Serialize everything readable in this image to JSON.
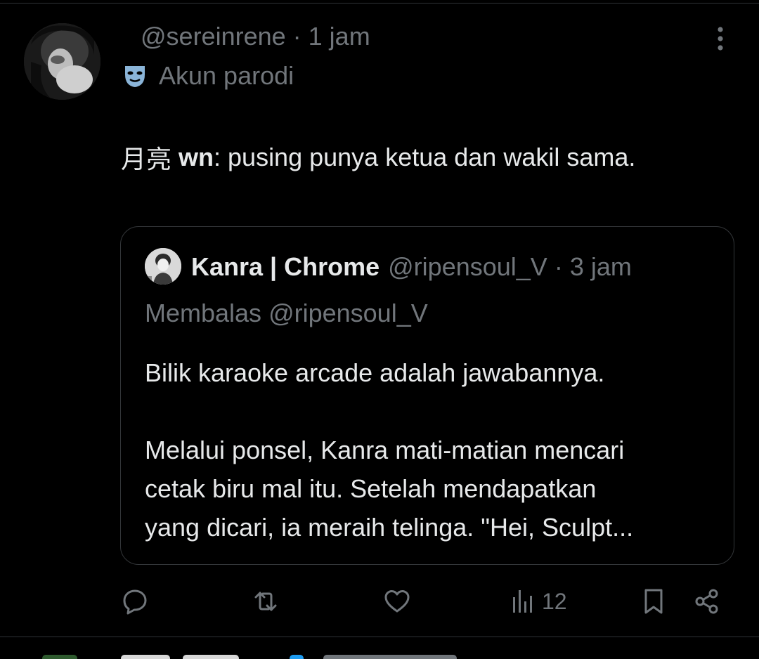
{
  "tweet": {
    "handle": "@sereinrene",
    "separator": "·",
    "time": "1 jam",
    "parody_label": "Akun parodi",
    "text_prefix": "月亮 ",
    "text_bold": "wn",
    "text_rest": ": pusing punya ketua dan wakil sama."
  },
  "quote": {
    "name": "Kanra | Chrome",
    "handle": "@ripensoul_V",
    "separator": "·",
    "time": "3 jam",
    "reply_to": "Membalas @ripensoul_V",
    "line1": "Bilik karaoke arcade adalah jawabannya.",
    "line2": "Melalui ponsel, Kanra mati-matian mencari",
    "line3": "cetak biru mal itu. Setelah mendapatkan",
    "line4": "yang dicari, ia meraih telinga. \"Hei, Sculpt..."
  },
  "actions": {
    "views_count": "12"
  },
  "icons": {
    "more": "more-vertical-icon",
    "parody": "theater-mask-icon",
    "reply": "reply-icon",
    "repost": "repost-icon",
    "like": "heart-icon",
    "views": "views-bar-chart-icon",
    "bookmark": "bookmark-icon",
    "share": "share-icon"
  },
  "colors": {
    "background": "#000000",
    "text_primary": "#e7e9ea",
    "text_secondary": "#71767b",
    "border": "#333639",
    "mask_accent": "#8ab4d8"
  }
}
